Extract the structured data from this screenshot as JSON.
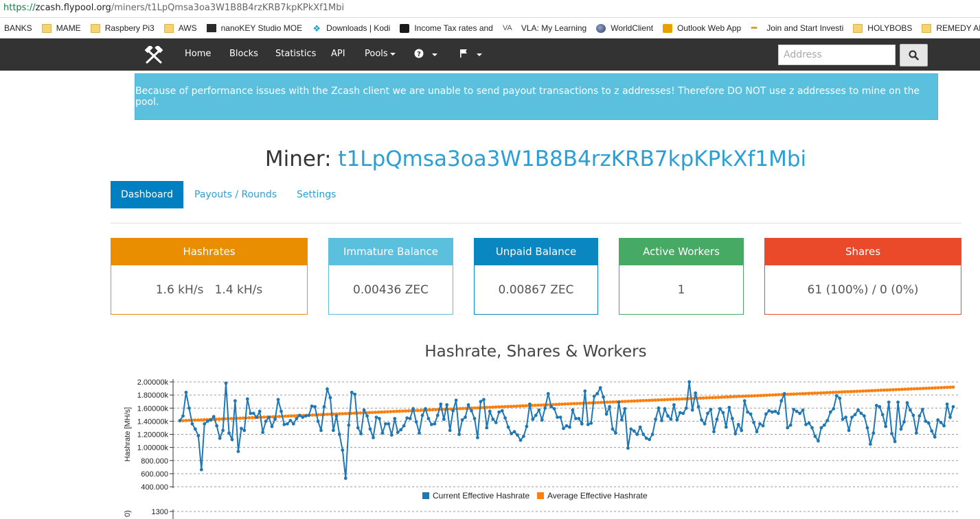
{
  "browser": {
    "url_scheme": "https://",
    "url_host": "zcash.flypool.org",
    "url_path": "/miners/t1LpQmsa3oa3W1B8B4rzKRB7kpKPkXf1Mbi",
    "bookmarks": [
      {
        "label": "BANKS",
        "icon": "none"
      },
      {
        "label": "MAME",
        "icon": "folder"
      },
      {
        "label": "Raspbery Pi3",
        "icon": "folder"
      },
      {
        "label": "AWS",
        "icon": "folder"
      },
      {
        "label": "nanoKEY Studio MOE",
        "icon": "dark"
      },
      {
        "label": "Downloads | Kodi",
        "icon": "kodi"
      },
      {
        "label": "Income Tax rates and",
        "icon": "crown"
      },
      {
        "label": "VLA: My Learning",
        "icon": "va"
      },
      {
        "label": "WorldClient",
        "icon": "globe"
      },
      {
        "label": "Outlook Web App",
        "icon": "outlook"
      },
      {
        "label": "Join and Start Investi",
        "icon": "dots"
      },
      {
        "label": "HOLYBOBS",
        "icon": "folder"
      },
      {
        "label": "REMEDY API",
        "icon": "folder"
      }
    ]
  },
  "navbar": {
    "home": "Home",
    "blocks": "Blocks",
    "statistics": "Statistics",
    "api": "API",
    "pools": "Pools",
    "help_icon": "question-circle-icon",
    "flag_icon": "flag-icon",
    "search_placeholder": "Address",
    "search_icon": "search-icon",
    "logo_icon": "crossed-hammers-icon"
  },
  "alert": {
    "text": "Because of performance issues with the Zcash client we are unable to send payout transactions to z addresses! Therefore DO NOT use z addresses to mine on the pool."
  },
  "miner": {
    "label": "Miner: ",
    "address": "t1LpQmsa3oa3W1B8B4rzKRB7kpKPkXf1Mbi"
  },
  "tabs": {
    "dashboard": "Dashboard",
    "payouts": "Payouts / Rounds",
    "settings": "Settings"
  },
  "stats": [
    {
      "title": "Hashrates",
      "value": "1.6 kH/s   1.4 kH/s",
      "color": "#e88e00"
    },
    {
      "title": "Immature Balance",
      "value": "0.00436 ZEC",
      "color": "#5bc0de"
    },
    {
      "title": "Unpaid Balance",
      "value": "0.00867 ZEC",
      "color": "#0a86c0"
    },
    {
      "title": "Active Workers",
      "value": "1",
      "color": "#47aa64"
    },
    {
      "title": "Shares",
      "value": "61 (100%) / 0 (0%)",
      "color": "#ea4a2a"
    }
  ],
  "chart_data": {
    "type": "line",
    "title": "Hashrate, Shares & Workers",
    "ylabel": "Hashrate [MH/s]",
    "ylim": [
      400,
      2000
    ],
    "y_ticks": [
      "2.00000k",
      "1.80000k",
      "1.60000k",
      "1.40000k",
      "1.20000k",
      "1.00000k",
      "800.000",
      "600.000",
      "400.000"
    ],
    "y_tick_values": [
      2000,
      1800,
      1600,
      1400,
      1200,
      1000,
      800,
      600,
      400
    ],
    "grid": true,
    "legend_position": "bottom",
    "series": [
      {
        "name": "Current Effective Hashrate",
        "color": "#1f77b4",
        "values": [
          1410,
          1480,
          1840,
          1600,
          1360,
          1280,
          1180,
          660,
          1360,
          1400,
          1420,
          1470,
          1330,
          1140,
          1260,
          1980,
          1220,
          1120,
          1710,
          940,
          1290,
          1260,
          1740,
          1520,
          1520,
          1460,
          1550,
          1230,
          1400,
          1460,
          1320,
          1430,
          1730,
          1550,
          1350,
          1360,
          1410,
          1360,
          1440,
          1490,
          1460,
          1480,
          1490,
          1630,
          1620,
          1400,
          1260,
          1620,
          1890,
          1760,
          1260,
          1480,
          1200,
          960,
          530,
          1340,
          1840,
          1810,
          1300,
          1210,
          1570,
          1480,
          1280,
          1150,
          1460,
          1440,
          1220,
          1360,
          1360,
          1190,
          1440,
          1230,
          1270,
          1330,
          1450,
          1440,
          1590,
          1390,
          1220,
          1490,
          1590,
          1440,
          1350,
          1360,
          1490,
          1660,
          1430,
          1650,
          1260,
          1560,
          1720,
          1200,
          1420,
          1460,
          1650,
          1560,
          1440,
          1150,
          1700,
          1730,
          1300,
          1550,
          1430,
          1380,
          1540,
          1560,
          1450,
          1310,
          1210,
          1240,
          1190,
          1110,
          1170,
          1320,
          1660,
          1430,
          1490,
          1570,
          1420,
          1600,
          1820,
          1620,
          1590,
          1460,
          1460,
          1290,
          1330,
          1310,
          1570,
          1440,
          1440,
          1360,
          1860,
          1350,
          1370,
          1780,
          1820,
          1910,
          1770,
          1510,
          1620,
          1280,
          1220,
          1690,
          1420,
          1590,
          990,
          1280,
          1250,
          1200,
          1310,
          1200,
          1140,
          1120,
          1200,
          1430,
          1600,
          1410,
          1590,
          1480,
          1430,
          1650,
          1420,
          1530,
          1520,
          1600,
          2000,
          1570,
          1830,
          1620,
          1420,
          1360,
          1520,
          1580,
          1240,
          1430,
          1590,
          1530,
          1310,
          1610,
          1440,
          1210,
          1350,
          1260,
          1710,
          1540,
          1510,
          1380,
          1240,
          1360,
          1330,
          1510,
          1560,
          1540,
          1550,
          1520,
          1710,
          1820,
          1300,
          1340,
          1580,
          1550,
          1520,
          1570,
          1350,
          1370,
          1300,
          1170,
          1100,
          1300,
          1340,
          1410,
          1540,
          1590,
          1790,
          1750,
          1430,
          1460,
          1260,
          1460,
          1500,
          1570,
          1520,
          1480,
          1300,
          1050,
          1220,
          1640,
          1620,
          1500,
          1320,
          1690,
          1210,
          1090,
          1690,
          1280,
          1390,
          1680,
          1570,
          1490,
          1220,
          1480,
          1580,
          1400,
          1370,
          1250,
          1160,
          1420,
          1380,
          1330,
          1660,
          1460,
          1620
        ]
      },
      {
        "name": "Average Effective Hashrate",
        "color": "#ff7f0e",
        "values": [
          1406,
          1408,
          1410,
          1412,
          1414,
          1416,
          1418,
          1420,
          1422,
          1424,
          1426,
          1428,
          1430,
          1432,
          1434,
          1436,
          1438,
          1440,
          1442,
          1444,
          1446,
          1448,
          1450,
          1452,
          1454,
          1456,
          1458,
          1460,
          1462,
          1464,
          1466,
          1468,
          1470,
          1472,
          1474,
          1476,
          1478,
          1480,
          1482,
          1484,
          1486,
          1488,
          1490,
          1492,
          1494,
          1496,
          1498,
          1500,
          1502,
          1504,
          1506,
          1508,
          1510,
          1512,
          1514,
          1516,
          1518,
          1520,
          1522,
          1524,
          1526,
          1528,
          1530,
          1532,
          1534,
          1536,
          1538,
          1540,
          1542,
          1544,
          1546,
          1548,
          1550,
          1552,
          1554,
          1556,
          1558,
          1560,
          1562,
          1564,
          1566,
          1568,
          1570,
          1572,
          1574,
          1576,
          1578,
          1580,
          1582,
          1584,
          1586,
          1588,
          1590,
          1592,
          1594,
          1596,
          1598,
          1600,
          1602,
          1604,
          1606,
          1608,
          1610,
          1612,
          1614,
          1616,
          1618,
          1620,
          1622,
          1624,
          1626,
          1628,
          1630,
          1632,
          1634,
          1636,
          1638,
          1640,
          1642,
          1644,
          1646,
          1648,
          1650,
          1652,
          1654,
          1656,
          1658,
          1660,
          1662,
          1664,
          1666,
          1668,
          1670,
          1672,
          1674,
          1676,
          1678,
          1680,
          1682,
          1684,
          1686,
          1688,
          1690,
          1692,
          1694,
          1696,
          1698,
          1700,
          1702,
          1704,
          1706,
          1708,
          1710,
          1712,
          1714,
          1716,
          1718,
          1720,
          1722,
          1724,
          1726,
          1728,
          1730,
          1732,
          1734,
          1736,
          1738,
          1740,
          1742,
          1744,
          1746,
          1748,
          1750,
          1752,
          1754,
          1756,
          1758,
          1760,
          1762,
          1764,
          1766,
          1768,
          1770,
          1772,
          1774,
          1776,
          1778,
          1780,
          1782,
          1784,
          1786,
          1788,
          1790,
          1792,
          1794,
          1796,
          1798,
          1800,
          1802,
          1804,
          1806,
          1808,
          1810,
          1812,
          1814,
          1816,
          1818,
          1820,
          1822,
          1824,
          1826,
          1828,
          1830,
          1832,
          1834,
          1836,
          1838,
          1840,
          1842,
          1844,
          1846,
          1848,
          1850,
          1852,
          1854,
          1856,
          1858,
          1860,
          1862,
          1864,
          1866,
          1868,
          1870,
          1872,
          1874,
          1876,
          1878,
          1880,
          1882,
          1884,
          1886,
          1888,
          1890,
          1892,
          1894,
          1896,
          1898,
          1900,
          1902,
          1904,
          1906,
          1908,
          1910,
          1912,
          1914,
          1916,
          1918,
          1920
        ]
      }
    ],
    "second_chart_tick": "1300",
    "second_chart_axis_fragment": "0)"
  }
}
